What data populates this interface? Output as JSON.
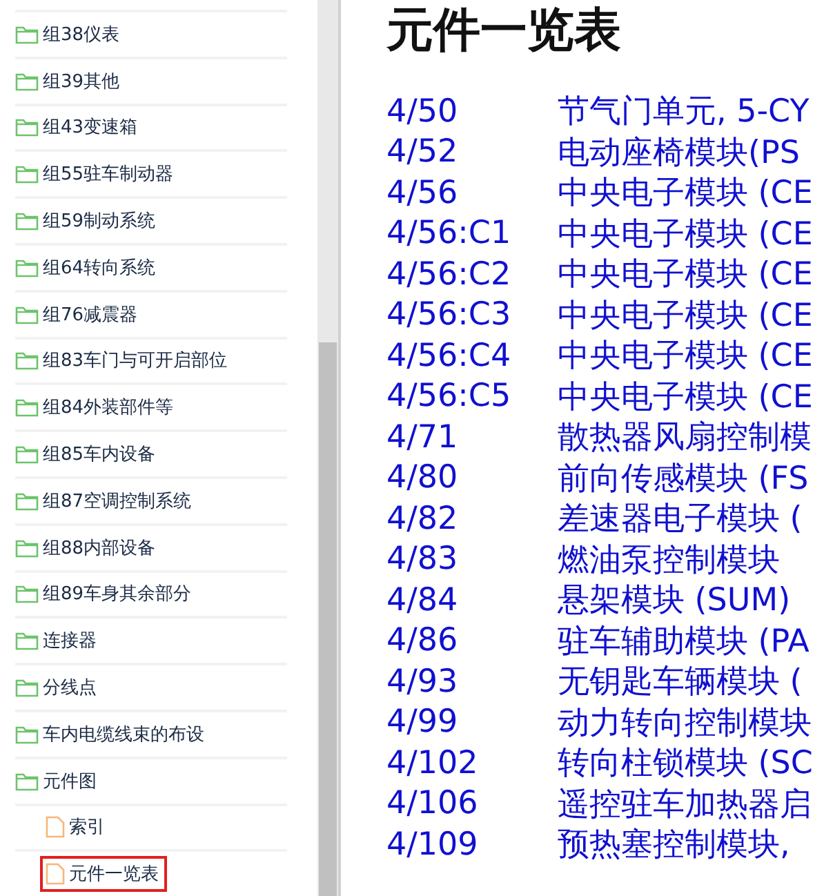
{
  "sidebar": {
    "items": [
      {
        "label": "组38仪表",
        "selected": false
      },
      {
        "label": "组39其他",
        "selected": false
      },
      {
        "label": "组43变速箱",
        "selected": false
      },
      {
        "label": "组55驻车制动器",
        "selected": false
      },
      {
        "label": "组59制动系统",
        "selected": false
      },
      {
        "label": "组64转向系统",
        "selected": false
      },
      {
        "label": "组76减震器",
        "selected": false
      },
      {
        "label": "组83车门与可开启部位",
        "selected": false
      },
      {
        "label": "组84外装部件等",
        "selected": false
      },
      {
        "label": "组85车内设备",
        "selected": false
      },
      {
        "label": "组87空调控制系统",
        "selected": false
      },
      {
        "label": "组88内部设备",
        "selected": false
      },
      {
        "label": "组89车身其余部分",
        "selected": false
      },
      {
        "label": "连接器",
        "selected": false
      },
      {
        "label": "分线点",
        "selected": false
      },
      {
        "label": "车内电缆线束的布设",
        "selected": false
      },
      {
        "label": "元件图",
        "selected": false,
        "children": [
          {
            "label": "索引",
            "selected": false
          },
          {
            "label": "元件一览表",
            "selected": true
          }
        ]
      }
    ]
  },
  "content": {
    "title": "元件一览表",
    "rows": [
      {
        "code": "4/50",
        "name": "节气门单元, 5-CY"
      },
      {
        "code": "4/52",
        "name": "电动座椅模块(PS"
      },
      {
        "code": "4/56",
        "name": "中央电子模块 (CE"
      },
      {
        "code": "4/56:C1",
        "name": "中央电子模块 (CE"
      },
      {
        "code": "4/56:C2",
        "name": "中央电子模块 (CE"
      },
      {
        "code": "4/56:C3",
        "name": "中央电子模块 (CE"
      },
      {
        "code": "4/56:C4",
        "name": "中央电子模块 (CE"
      },
      {
        "code": "4/56:C5",
        "name": "中央电子模块 (CE"
      },
      {
        "code": "4/71",
        "name": "散热器风扇控制模"
      },
      {
        "code": "4/80",
        "name": "前向传感模块 (FS"
      },
      {
        "code": "4/82",
        "name": "差速器电子模块 ("
      },
      {
        "code": "4/83",
        "name": "燃油泵控制模块"
      },
      {
        "code": "4/84",
        "name": "悬架模块 (SUM)"
      },
      {
        "code": "4/86",
        "name": "驻车辅助模块 (PA"
      },
      {
        "code": "4/93",
        "name": "无钥匙车辆模块 ("
      },
      {
        "code": "4/99",
        "name": "动力转向控制模块"
      },
      {
        "code": "4/102",
        "name": "转向柱锁模块 (SC"
      },
      {
        "code": "4/106",
        "name": "遥控驻车加热器启"
      },
      {
        "code": "4/109",
        "name": "预热塞控制模块,"
      }
    ]
  }
}
